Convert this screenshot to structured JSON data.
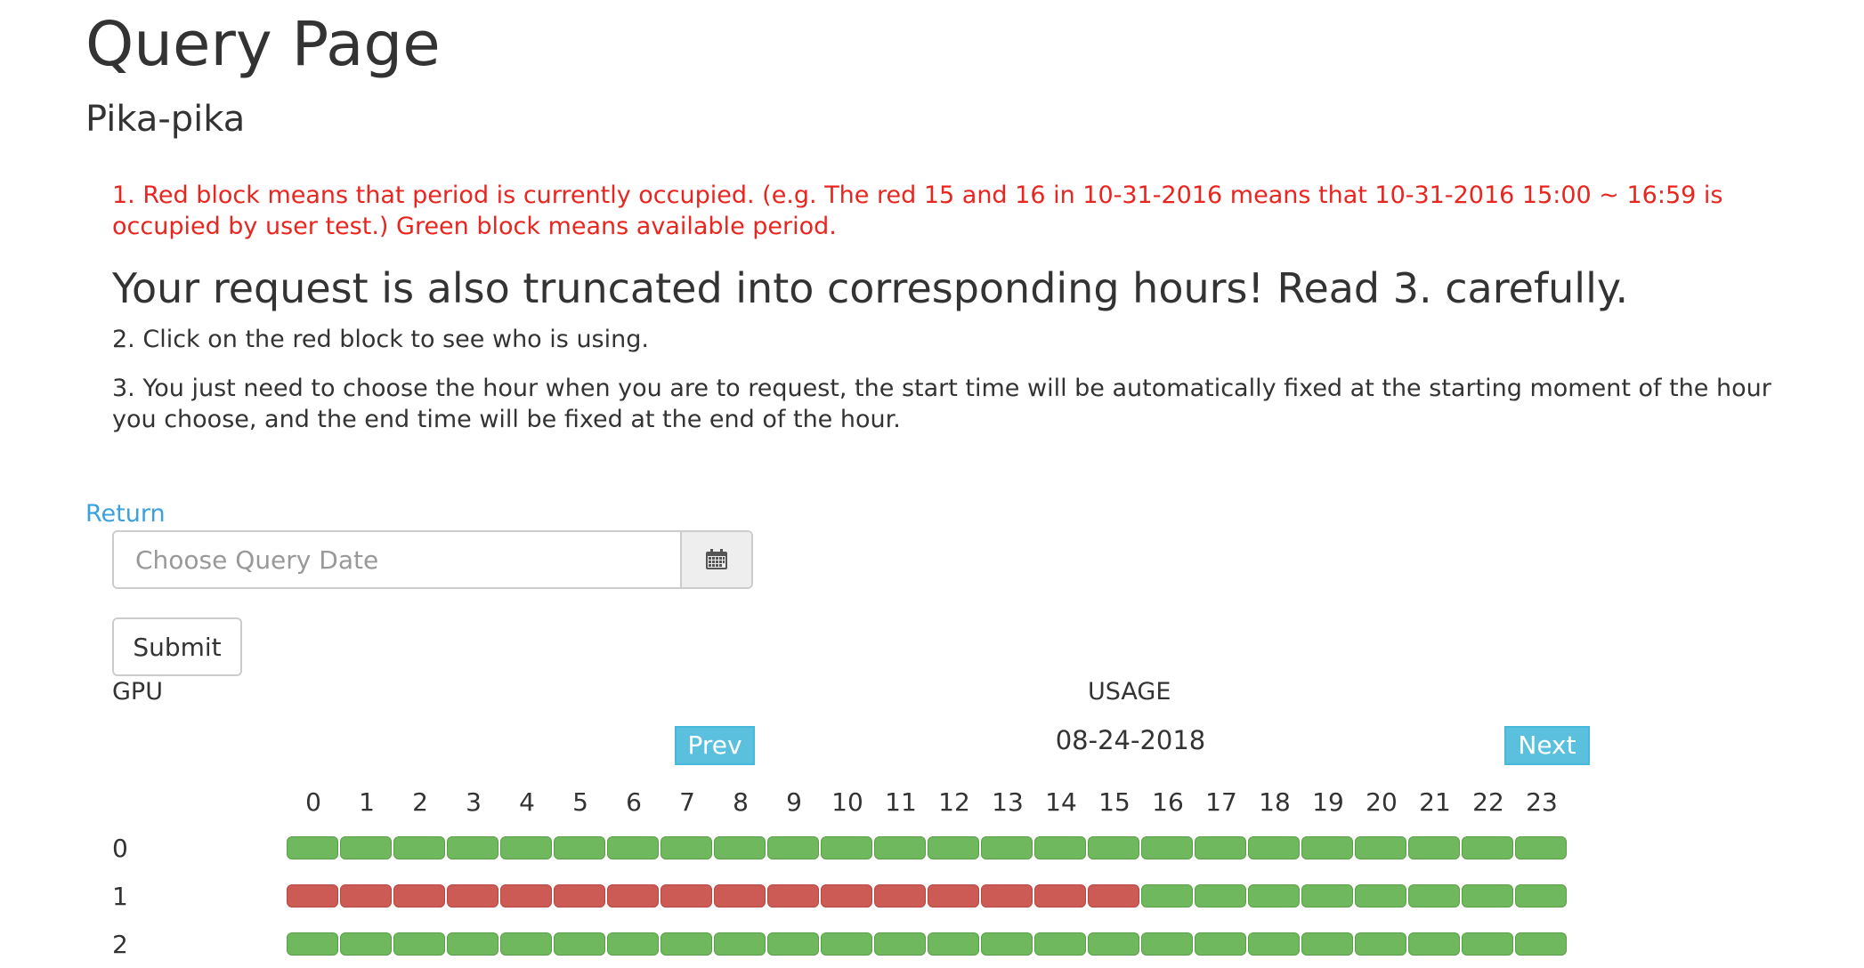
{
  "page": {
    "title": "Query Page",
    "subtitle": "Pika-pika"
  },
  "notes": {
    "note1": "1. Red block means that period is currently occupied. (e.g. The red 15 and 16 in 10-31-2016 means that 10-31-2016 15:00 ~ 16:59 is occupied by user test.) Green block means available period.",
    "headline": "Your request is also truncated into corresponding hours! Read 3. carefully.",
    "note2": "2. Click on the red block to see who is using.",
    "note3": "3. You just need to choose the hour when you are to request, the start time will be automatically fixed at the starting moment of the hour you choose, and the end time will be fixed at the end of the hour."
  },
  "return_link": "Return",
  "date_picker": {
    "placeholder": "Choose Query Date",
    "icon": "calendar-icon"
  },
  "submit_label": "Submit",
  "table": {
    "gpu_header": "GPU",
    "usage_header": "USAGE",
    "prev_label": "Prev",
    "next_label": "Next",
    "current_date": "08-24-2018",
    "hours": [
      "0",
      "1",
      "2",
      "3",
      "4",
      "5",
      "6",
      "7",
      "8",
      "9",
      "10",
      "11",
      "12",
      "13",
      "14",
      "15",
      "16",
      "17",
      "18",
      "19",
      "20",
      "21",
      "22",
      "23"
    ],
    "rows": [
      {
        "gpu": "0",
        "occupied_hours": []
      },
      {
        "gpu": "1",
        "occupied_hours": [
          0,
          1,
          2,
          3,
          4,
          5,
          6,
          7,
          8,
          9,
          10,
          11,
          12,
          13,
          14,
          15
        ]
      },
      {
        "gpu": "2",
        "occupied_hours": []
      }
    ]
  },
  "colors": {
    "occupied": "#cd5b55",
    "available": "#70b85e",
    "note_red": "#e8251f",
    "link": "#3aa0e0",
    "nav_button": "#5bc0de"
  }
}
